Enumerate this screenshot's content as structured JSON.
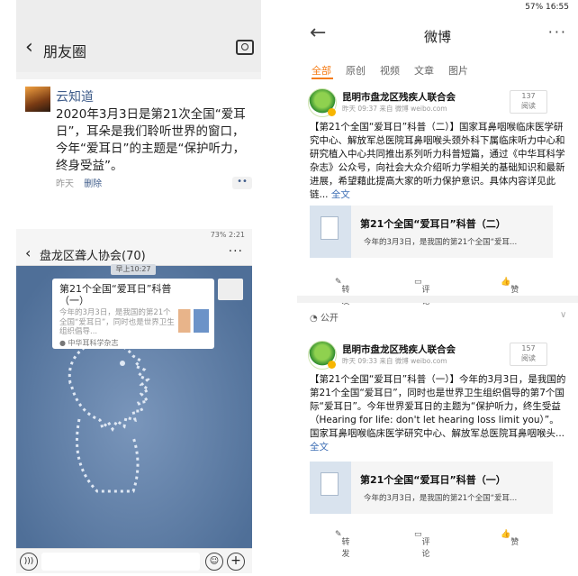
{
  "moments": {
    "top_text": "",
    "title": "朋友圈",
    "post": {
      "user": "云知道",
      "text": "2020年3月3日是第21次全国“爱耳日”，耳朵是我们聆听世界的窗口，今年“爱耳日”的主题是“保护听力，终身受益”。",
      "time": "昨天",
      "delete": "删除"
    }
  },
  "chat": {
    "status_left": "",
    "status_right": "73%  2:21",
    "group_name": "盘龙区聋人协会",
    "member_count": "(70)",
    "time_label": "早上10:27",
    "card": {
      "title": "第21个全国“爱耳日”科普（一）",
      "desc": "今年的3月3日，是我国的第21个全国“爱耳日”，同时也是世界卫生组织倡导...",
      "source": "中华耳科学杂志"
    }
  },
  "weibo": {
    "status": "57%  16:55",
    "title": "微博",
    "tabs": [
      "全部",
      "原创",
      "视频",
      "文章",
      "图片"
    ],
    "public_label": "公开",
    "posts": [
      {
        "author": "昆明市盘龙区残疾人联合会",
        "meta": "昨天 09:37 来自 微博 weibo.com",
        "reads_count": "137",
        "reads_label": "阅读",
        "text": "【第21个全国“爱耳日”科普（二）】国家耳鼻咽喉临床医学研究中心、解放军总医院耳鼻咽喉头颈外科下属临床听力中心和研究植入中心共同推出系列听力科普短篇，通过《中华耳科学杂志》公众号，向社会大众介绍听力学相关的基础知识和最新进展，希望藉此提高大家的听力保护意识。具体内容详见此链...",
        "full_link": "全文",
        "card_title": "第21个全国“爱耳日”科普（二）",
        "card_desc": "今年的3月3日，是我国的第21个全国“爱耳...",
        "repost": "转发",
        "comment": "评论",
        "like": "赞"
      },
      {
        "author": "昆明市盘龙区残疾人联合会",
        "meta": "昨天 09:33 来自 微博 weibo.com",
        "reads_count": "157",
        "reads_label": "阅读",
        "text": "【第21个全国“爱耳日”科普（一）】今年的3月3日，是我国的第21个全国“爱耳日”，同时也是世界卫生组织倡导的第7个国际“爱耳日”。今年世界爱耳日的主题为“保护听力，终生受益（Hearing for life: don't let hearing loss limit you）”。国家耳鼻咽喉临床医学研究中心、解放军总医院耳鼻咽喉头...",
        "full_link": "全文",
        "card_title": "第21个全国“爱耳日”科普（一）",
        "card_desc": "今年的3月3日，是我国的第21个全国“爱耳...",
        "repost": "转发",
        "comment": "评论",
        "like": "赞"
      }
    ]
  }
}
